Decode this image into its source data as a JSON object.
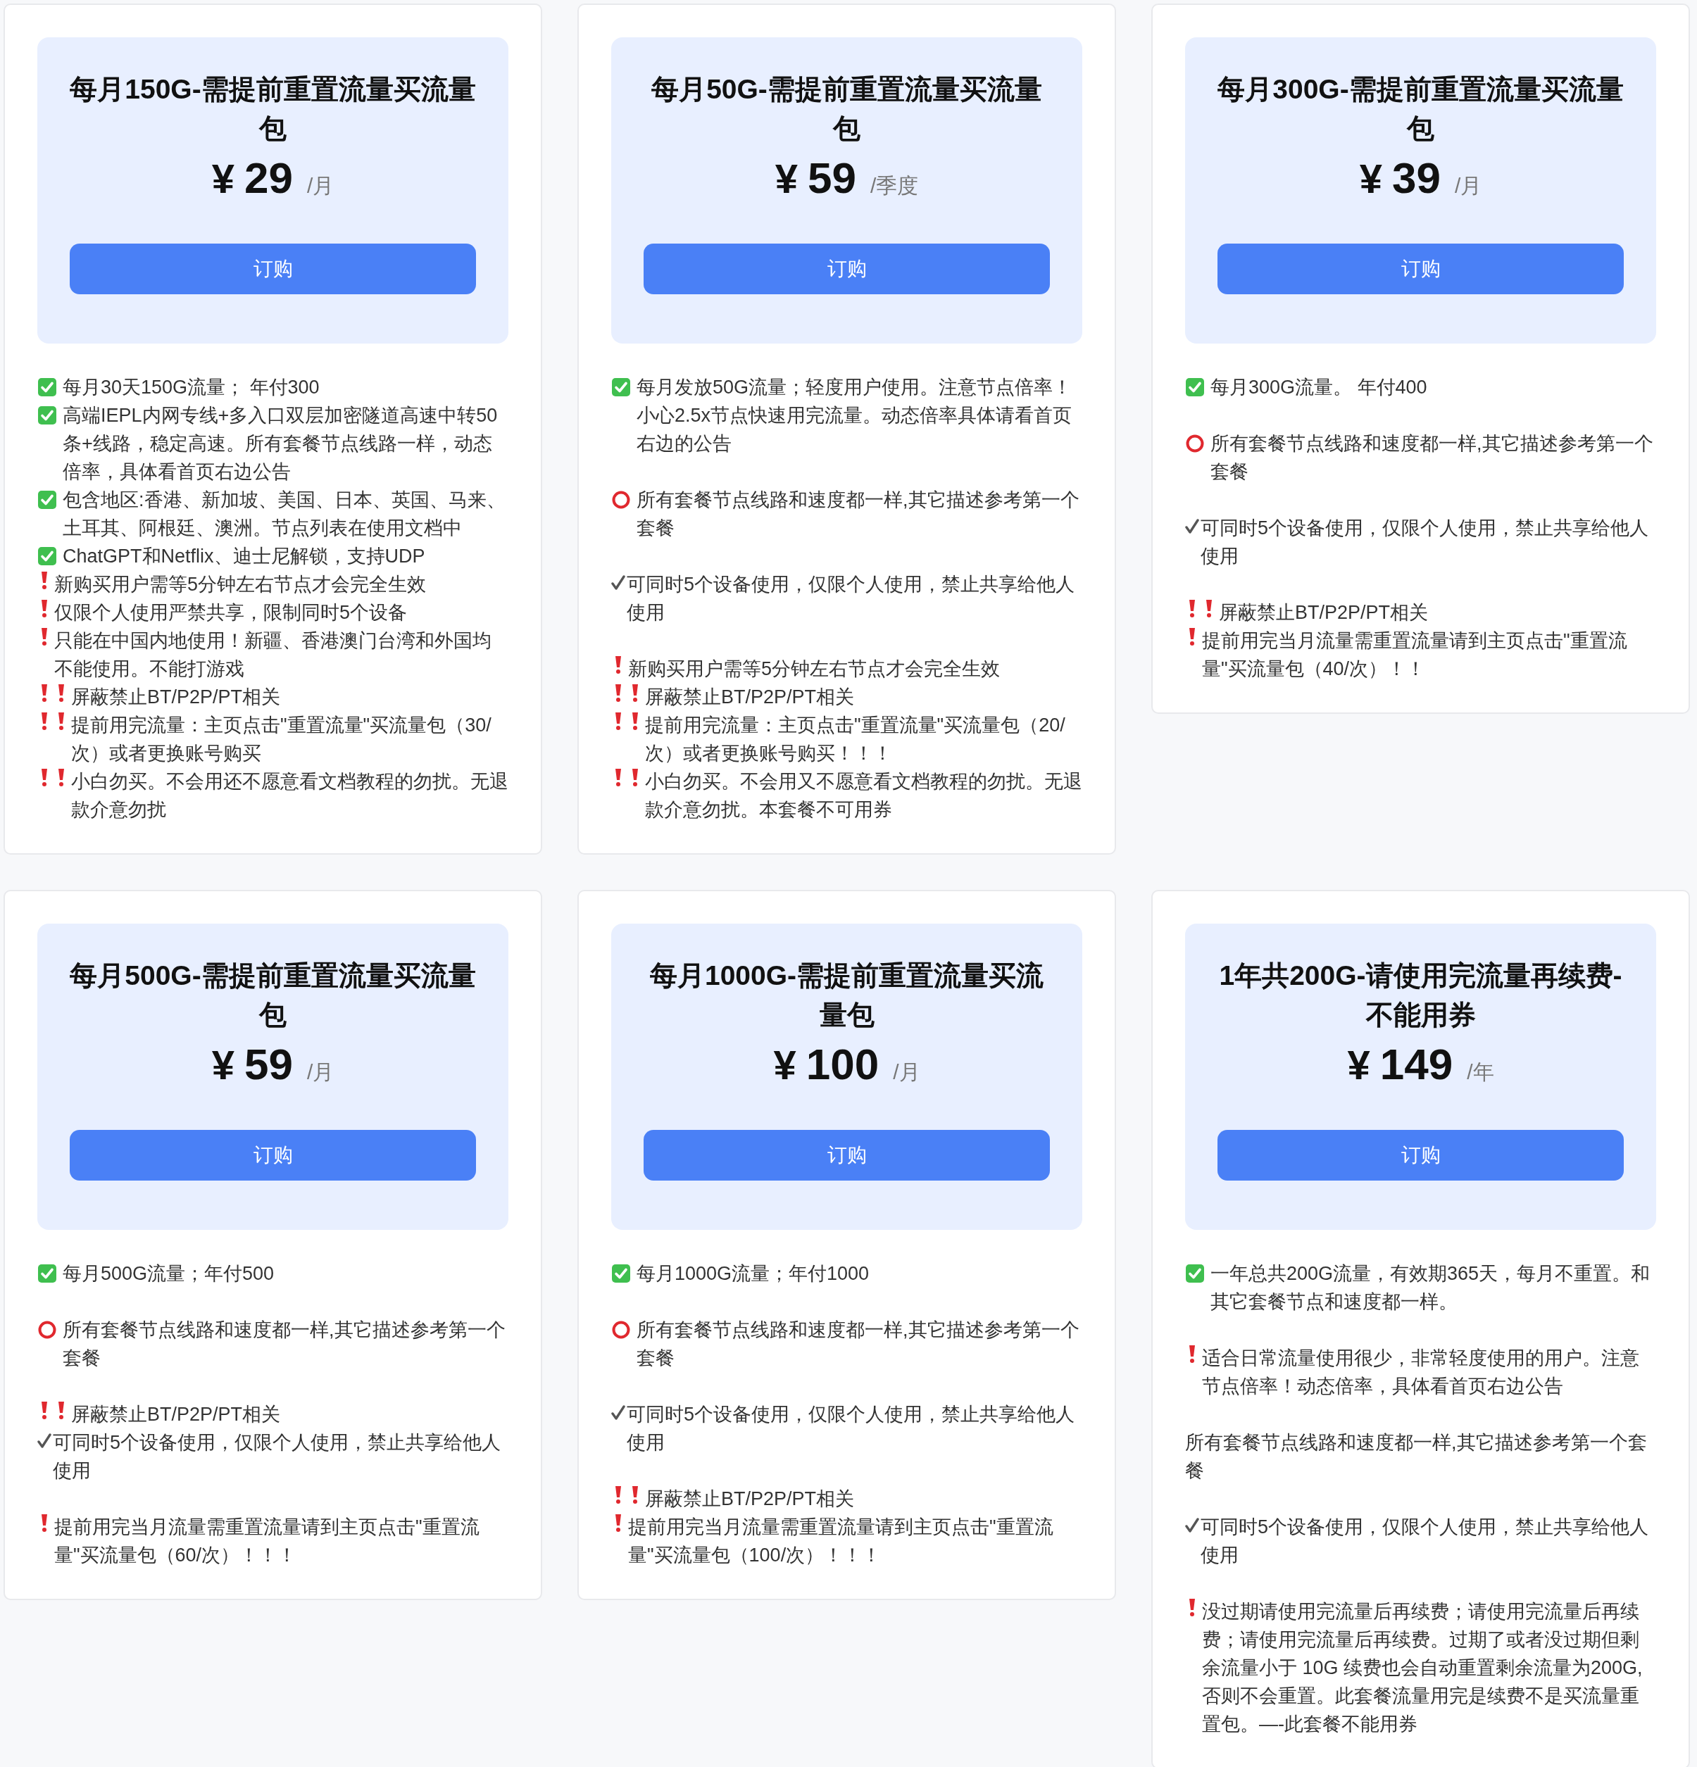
{
  "plans": [
    {
      "title": "每月150G-需提前重置流量买流量包",
      "currency": "¥",
      "amount": "29",
      "period": "/月",
      "button": "订购",
      "blocks": [
        {
          "lines": [
            {
              "kind": "checkbox",
              "text": "每月30天150G流量；  年付300"
            },
            {
              "kind": "checkbox",
              "text": "高端IEPL内网专线+多入口双层加密隧道高速中转50条+线路，稳定高速。所有套餐节点线路一样，动态倍率，具体看首页右边公告"
            },
            {
              "kind": "checkbox",
              "text": "包含地区:香港、新加坡、美国、日本、英国、马来、土耳其、阿根廷、澳洲。节点列表在使用文档中"
            },
            {
              "kind": "checkbox",
              "text": "ChatGPT和Netflix、迪士尼解锁，支持UDP"
            },
            {
              "kind": "bang",
              "text": "新购买用户需等5分钟左右节点才会完全生效"
            },
            {
              "kind": "bang",
              "text": "仅限个人使用严禁共享，限制同时5个设备"
            },
            {
              "kind": "bang",
              "text": "只能在中国内地使用！新疆、香港澳门台湾和外国均不能使用。不能打游戏"
            },
            {
              "kind": "bang2",
              "text": "屏蔽禁止BT/P2P/PT相关"
            },
            {
              "kind": "bang2",
              "text": "提前用完流量：主页点击\"重置流量\"买流量包（30/次）或者更换账号购买"
            },
            {
              "kind": "bang2",
              "text": "小白勿买。不会用还不愿意看文档教程的勿扰。无退款介意勿扰"
            }
          ]
        }
      ]
    },
    {
      "title": "每月50G-需提前重置流量买流量包",
      "currency": "¥",
      "amount": "59",
      "period": "/季度",
      "button": "订购",
      "blocks": [
        {
          "lines": [
            {
              "kind": "checkbox",
              "text": "每月发放50G流量；轻度用户使用。注意节点倍率！小心2.5x节点快速用完流量。动态倍率具体请看首页右边的公告"
            }
          ]
        },
        {
          "lines": [
            {
              "kind": "ring",
              "text": "所有套餐节点线路和速度都一样,其它描述参考第一个套餐"
            }
          ]
        },
        {
          "lines": [
            {
              "kind": "tick",
              "text": "可同时5个设备使用，仅限个人使用，禁止共享给他人使用"
            }
          ]
        },
        {
          "lines": [
            {
              "kind": "bang",
              "text": "新购买用户需等5分钟左右节点才会完全生效"
            },
            {
              "kind": "bang2",
              "text": "屏蔽禁止BT/P2P/PT相关"
            },
            {
              "kind": "bang2",
              "text": "提前用完流量：主页点击\"重置流量\"买流量包（20/次）或者更换账号购买！！！"
            },
            {
              "kind": "bang2",
              "text": "小白勿买。不会用又不愿意看文档教程的勿扰。无退款介意勿扰。本套餐不可用券"
            }
          ]
        }
      ]
    },
    {
      "title": "每月300G-需提前重置流量买流量包",
      "currency": "¥",
      "amount": "39",
      "period": "/月",
      "button": "订购",
      "blocks": [
        {
          "lines": [
            {
              "kind": "checkbox",
              "text": "每月300G流量。 年付400"
            }
          ]
        },
        {
          "lines": [
            {
              "kind": "ring",
              "text": "所有套餐节点线路和速度都一样,其它描述参考第一个套餐"
            }
          ]
        },
        {
          "lines": [
            {
              "kind": "tick",
              "text": "可同时5个设备使用，仅限个人使用，禁止共享给他人使用"
            }
          ]
        },
        {
          "lines": [
            {
              "kind": "bang2",
              "text": "屏蔽禁止BT/P2P/PT相关"
            },
            {
              "kind": "bang",
              "text": "提前用完当月流量需重置流量请到主页点击\"重置流量\"买流量包（40/次）！！"
            }
          ]
        }
      ]
    },
    {
      "title": "每月500G-需提前重置流量买流量包",
      "currency": "¥",
      "amount": "59",
      "period": "/月",
      "button": "订购",
      "blocks": [
        {
          "lines": [
            {
              "kind": "checkbox",
              "text": "每月500G流量；年付500"
            }
          ]
        },
        {
          "lines": [
            {
              "kind": "ring",
              "text": "所有套餐节点线路和速度都一样,其它描述参考第一个套餐"
            }
          ]
        },
        {
          "lines": [
            {
              "kind": "bang2",
              "text": "屏蔽禁止BT/P2P/PT相关"
            },
            {
              "kind": "tick",
              "text": "可同时5个设备使用，仅限个人使用，禁止共享给他人使用"
            }
          ]
        },
        {
          "lines": [
            {
              "kind": "bang",
              "text": "提前用完当月流量需重置流量请到主页点击\"重置流量\"买流量包（60/次）！！！"
            }
          ]
        }
      ]
    },
    {
      "title": "每月1000G-需提前重置流量买流量包",
      "currency": "¥",
      "amount": "100",
      "period": "/月",
      "button": "订购",
      "blocks": [
        {
          "lines": [
            {
              "kind": "checkbox",
              "text": "每月1000G流量；年付1000"
            }
          ]
        },
        {
          "lines": [
            {
              "kind": "ring",
              "text": "所有套餐节点线路和速度都一样,其它描述参考第一个套餐"
            }
          ]
        },
        {
          "lines": [
            {
              "kind": "tick",
              "text": "可同时5个设备使用，仅限个人使用，禁止共享给他人使用"
            }
          ]
        },
        {
          "lines": [
            {
              "kind": "bang2",
              "text": "屏蔽禁止BT/P2P/PT相关"
            },
            {
              "kind": "bang",
              "text": "提前用完当月流量需重置流量请到主页点击\"重置流量\"买流量包（100/次）！！！"
            }
          ]
        }
      ]
    },
    {
      "title": "1年共200G-请使用完流量再续费-不能用券",
      "currency": "¥",
      "amount": "149",
      "period": "/年",
      "button": "订购",
      "blocks": [
        {
          "lines": [
            {
              "kind": "checkbox",
              "text": "一年总共200G流量，有效期365天，每月不重置。和其它套餐节点和速度都一样。"
            }
          ]
        },
        {
          "lines": [
            {
              "kind": "bang",
              "text": "适合日常流量使用很少，非常轻度使用的用户。注意节点倍率！动态倍率，具体看首页右边公告"
            }
          ]
        },
        {
          "lines": [
            {
              "kind": "none",
              "text": "所有套餐节点线路和速度都一样,其它描述参考第一个套餐"
            }
          ]
        },
        {
          "lines": [
            {
              "kind": "tick",
              "text": "可同时5个设备使用，仅限个人使用，禁止共享给他人使用"
            }
          ]
        },
        {
          "lines": [
            {
              "kind": "bang",
              "text": "没过期请使用完流量后再续费；请使用完流量后再续费；请使用完流量后再续费。过期了或者没过期但剩余流量小于 10G 续费也会自动重置剩余流量为200G,否则不会重置。此套餐流量用完是续费不是买流量重置包。—-此套餐不能用券"
            }
          ]
        }
      ]
    }
  ]
}
